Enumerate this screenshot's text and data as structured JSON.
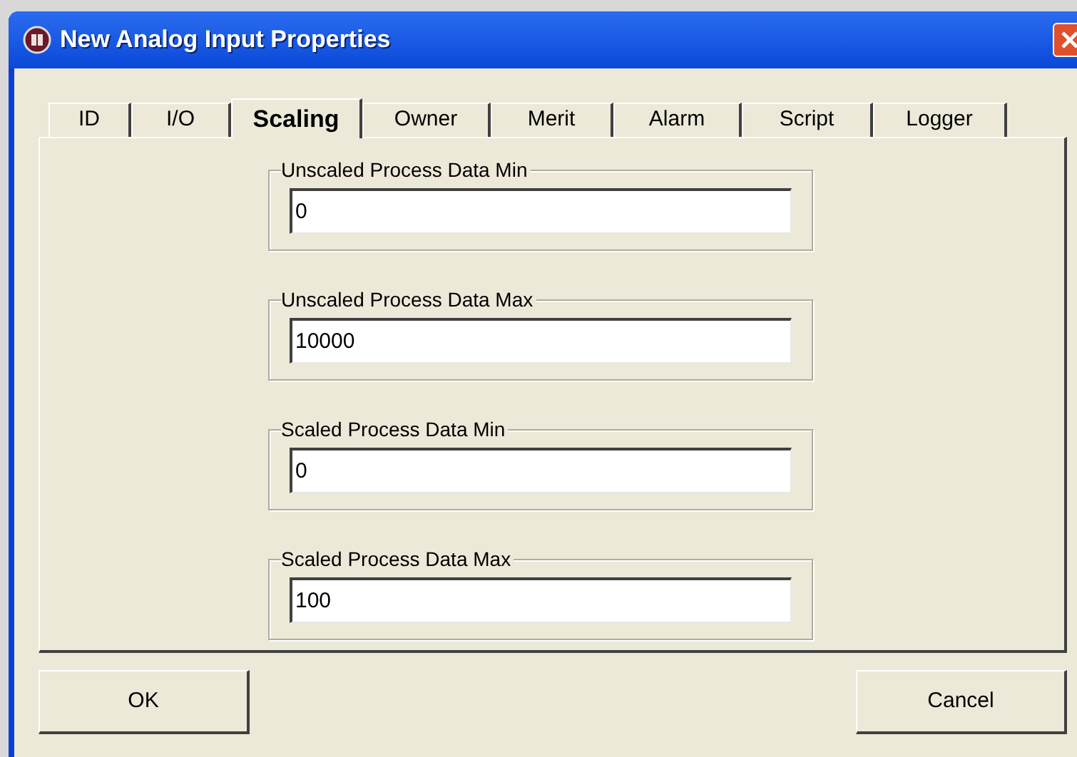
{
  "window": {
    "title": "New Analog Input Properties"
  },
  "tabs": [
    {
      "label": "ID",
      "selected": false
    },
    {
      "label": "I/O",
      "selected": false
    },
    {
      "label": "Scaling",
      "selected": true
    },
    {
      "label": "Owner",
      "selected": false
    },
    {
      "label": "Merit",
      "selected": false
    },
    {
      "label": "Alarm",
      "selected": false
    },
    {
      "label": "Script",
      "selected": false
    },
    {
      "label": "Logger",
      "selected": false
    }
  ],
  "groups": [
    {
      "label": "Unscaled Process Data Min",
      "value": "0"
    },
    {
      "label": "Unscaled Process Data Max",
      "value": "10000"
    },
    {
      "label": "Scaled Process Data Min",
      "value": "0"
    },
    {
      "label": "Scaled Process Data Max",
      "value": "100"
    }
  ],
  "buttons": [
    "OK",
    "Cancel"
  ]
}
